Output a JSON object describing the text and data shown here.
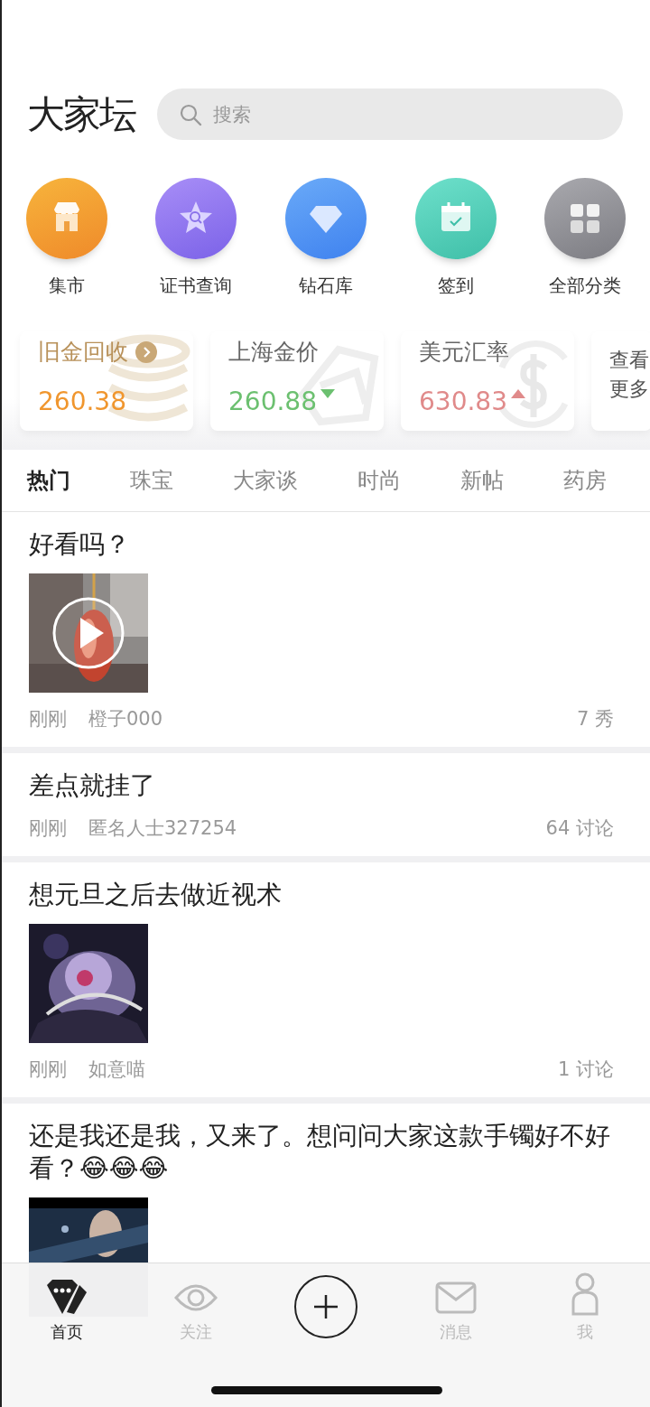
{
  "header": {
    "logo": "大家坛",
    "search": {
      "placeholder": "搜索"
    }
  },
  "shortcuts": [
    {
      "label": "集市"
    },
    {
      "label": "证书查询"
    },
    {
      "label": "钻石库"
    },
    {
      "label": "签到"
    },
    {
      "label": "全部分类"
    }
  ],
  "price_cards": [
    {
      "title": "旧金回收",
      "value": "260.38",
      "kind": "flat",
      "link": true
    },
    {
      "title": "上海金价",
      "value": "260.88",
      "kind": "down",
      "link": false
    },
    {
      "title": "美元汇率",
      "value": "630.83",
      "kind": "up",
      "link": false
    },
    {
      "title": "查看更多",
      "kind": "more"
    }
  ],
  "tabs": [
    {
      "label": "热门",
      "selected": true
    },
    {
      "label": "珠宝",
      "selected": false
    },
    {
      "label": "大家谈",
      "selected": false
    },
    {
      "label": "时尚",
      "selected": false
    },
    {
      "label": "新帖",
      "selected": false
    },
    {
      "label": "药房",
      "selected": false
    }
  ],
  "posts": [
    {
      "title": "好看吗？",
      "kind": "video",
      "time": "刚刚",
      "author": "橙子000",
      "stat": "7 秀"
    },
    {
      "title": "差点就挂了",
      "kind": "text",
      "time": "刚刚",
      "author": "匿名人士327254",
      "stat": "64 讨论"
    },
    {
      "title": "想元旦之后去做近视术",
      "kind": "picture",
      "time": "刚刚",
      "author": "如意喵",
      "stat": "1 讨论"
    },
    {
      "title": "还是我还是我，又来了。想问问大家这款手镯好不好看？😂😂😂",
      "kind": "picture"
    }
  ],
  "bottom_nav": [
    {
      "label": "首页",
      "selected": true,
      "kind": "tab"
    },
    {
      "label": "关注",
      "selected": false,
      "kind": "tab"
    },
    {
      "kind": "compose"
    },
    {
      "label": "消息",
      "selected": false,
      "kind": "tab"
    },
    {
      "label": "我",
      "selected": false,
      "kind": "tab"
    }
  ]
}
